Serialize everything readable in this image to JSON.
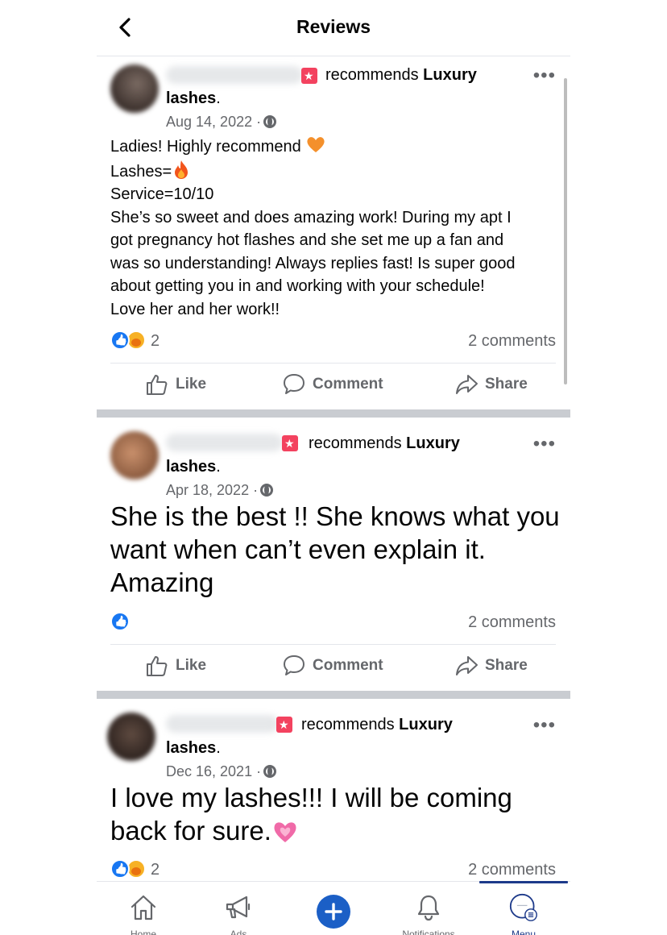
{
  "header": {
    "title": "Reviews",
    "back_icon": "chevron-left-icon"
  },
  "posts": [
    {
      "recommends_text": "recommends",
      "page_name_first": "Luxury",
      "page_name_second": "lashes",
      "period": ".",
      "date": "Aug 14, 2022 ·",
      "body_lines": [
        "Ladies! Highly recommend",
        "Lashes=",
        "Service=10/10",
        "She’s so sweet and does amazing work! During my apt I",
        "got pregnancy hot flashes and she set me up a fan and",
        "was so understanding! Always replies fast! Is super good",
        "about getting you in and working with your schedule!",
        "Love her and her work!!"
      ],
      "reaction_count": "2",
      "comments": "2 comments",
      "reactions": [
        "like",
        "care"
      ]
    },
    {
      "recommends_text": "recommends",
      "page_name_first": "Luxury",
      "page_name_second": "lashes",
      "period": ".",
      "date": "Apr 18, 2022 ·",
      "body_lines": [
        "She is the best !! She knows what you",
        "want when can’t even explain it.",
        "Amazing"
      ],
      "comments": "2 comments",
      "reactions": [
        "like"
      ]
    },
    {
      "recommends_text": "recommends",
      "page_name_first": "Luxury",
      "page_name_second": "lashes",
      "period": ".",
      "date": "Dec 16, 2021 ·",
      "body_lines": [
        "I love my lashes!!! I will be coming",
        "back for sure."
      ],
      "reaction_count": "2",
      "comments": "2 comments",
      "reactions": [
        "like",
        "care"
      ]
    }
  ],
  "actions": {
    "like": "Like",
    "comment": "Comment",
    "share": "Share"
  },
  "more_label": "•••",
  "tabbar": {
    "home": "Home",
    "ads": "Ads",
    "notifications": "Notifications",
    "menu": "Menu"
  },
  "colors": {
    "facebook_blue": "#1877f2",
    "recommend_red": "#f3425f",
    "secondary_text": "#65676b",
    "plus_button": "#1b5fc6",
    "menu_indicator": "#1d3a8a"
  }
}
